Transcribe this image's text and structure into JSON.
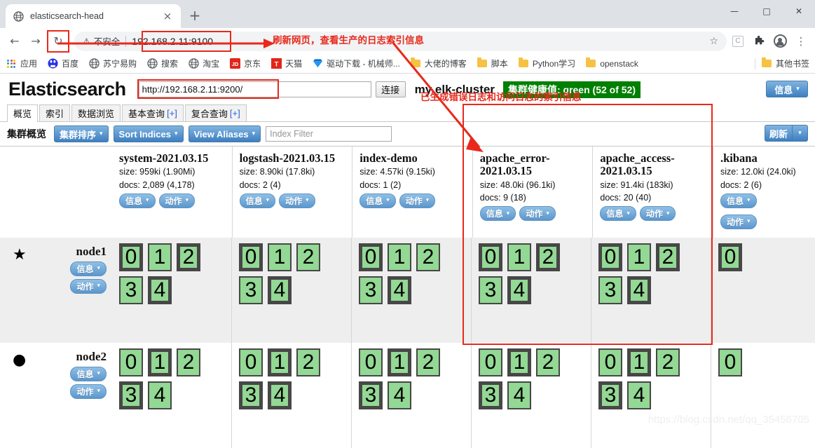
{
  "browser": {
    "tab": {
      "title": "elasticsearch-head",
      "favicon": "globe-icon",
      "close": "×"
    },
    "newtab_label": "+",
    "window_controls": {
      "minimize": "—",
      "maximize": "□",
      "close": "✕"
    },
    "nav": {
      "back": "←",
      "forward": "→",
      "reload": "↻"
    },
    "omnibox": {
      "security_label": "不安全",
      "warning_glyph": "⚠",
      "url": "192.168.2.11:9100",
      "star": "☆",
      "kebab": "⋮"
    },
    "bookmarks": [
      {
        "label": "应用",
        "icon": "apps-grid-icon"
      },
      {
        "label": "百度",
        "icon": "baidu-icon"
      },
      {
        "label": "苏宁易购",
        "icon": "globe-icon"
      },
      {
        "label": "搜索",
        "icon": "globe-icon"
      },
      {
        "label": "淘宝",
        "icon": "globe-icon"
      },
      {
        "label": "京东",
        "icon": "jd-icon"
      },
      {
        "label": "天猫",
        "icon": "tmall-icon"
      },
      {
        "label": "驱动下载 - 机械师...",
        "icon": "diamond-icon"
      },
      {
        "label": "大佬的博客",
        "icon": "folder-icon"
      },
      {
        "label": "脚本",
        "icon": "folder-icon"
      },
      {
        "label": "Python学习",
        "icon": "folder-icon"
      },
      {
        "label": "openstack",
        "icon": "folder-icon"
      }
    ],
    "other_bookmarks": {
      "label": "其他书签",
      "icon": "folder-icon"
    }
  },
  "app": {
    "logo": "Elasticsearch",
    "connect_url_value": "http://192.168.2.11:9200/",
    "connect_button": "连接",
    "cluster_name": "my elk-cluster",
    "health_badge": "集群健康值: green (52 of 52)",
    "health_color": "#008000",
    "info_button": "信息",
    "caret": "▾",
    "tabs": [
      {
        "label": "概览",
        "plus": "",
        "active": true
      },
      {
        "label": "索引",
        "plus": "",
        "active": false
      },
      {
        "label": "数据浏览",
        "plus": "",
        "active": false
      },
      {
        "label": "基本查询",
        "plus": "[+]",
        "active": false
      },
      {
        "label": "复合查询",
        "plus": "[+]",
        "active": false
      }
    ],
    "subbar": {
      "title": "集群概览",
      "sort_cluster": "集群排序",
      "sort_indices": "Sort Indices",
      "view_aliases": "View Aliases",
      "index_filter_placeholder": "Index Filter",
      "refresh": "刷新"
    },
    "buttons": {
      "info": "信息",
      "action": "动作"
    }
  },
  "cluster": {
    "indices": [
      {
        "name": "system-2021.03.15",
        "size": "size: 959ki (1.90Mi)",
        "docs": "docs: 2,089 (4,178)",
        "highlighted": false
      },
      {
        "name": "logstash-2021.03.15",
        "size": "size: 8.90ki (17.8ki)",
        "docs": "docs: 2 (4)",
        "highlighted": false
      },
      {
        "name": "index-demo",
        "size": "size: 4.57ki (9.15ki)",
        "docs": "docs: 1 (2)",
        "highlighted": false
      },
      {
        "name": "apache_error-2021.03.15",
        "size": "size: 48.0ki (96.1ki)",
        "docs": "docs: 9 (18)",
        "highlighted": true
      },
      {
        "name": "apache_access-2021.03.15",
        "size": "size: 91.4ki (183ki)",
        "docs": "docs: 20 (40)",
        "highlighted": true
      },
      {
        "name": ".kibana",
        "size": "size: 12.0ki (24.0ki)",
        "docs": "docs: 2 (6)",
        "highlighted": false
      }
    ],
    "nodes": [
      {
        "name": "node1",
        "marker": "★",
        "marker_title": "master-node-star-icon",
        "shards": [
          [
            {
              "n": "0",
              "p": true
            },
            {
              "n": "1",
              "p": false
            },
            {
              "n": "2",
              "p": true
            },
            {
              "n": "3",
              "p": false
            },
            {
              "n": "4",
              "p": true
            }
          ],
          [
            {
              "n": "0",
              "p": true
            },
            {
              "n": "1",
              "p": false
            },
            {
              "n": "2",
              "p": false
            },
            {
              "n": "3",
              "p": false
            },
            {
              "n": "4",
              "p": true
            }
          ],
          [
            {
              "n": "0",
              "p": true
            },
            {
              "n": "1",
              "p": false
            },
            {
              "n": "2",
              "p": false
            },
            {
              "n": "3",
              "p": false
            },
            {
              "n": "4",
              "p": true
            }
          ],
          [
            {
              "n": "0",
              "p": true
            },
            {
              "n": "1",
              "p": false
            },
            {
              "n": "2",
              "p": true
            },
            {
              "n": "3",
              "p": false
            },
            {
              "n": "4",
              "p": true
            }
          ],
          [
            {
              "n": "0",
              "p": true
            },
            {
              "n": "1",
              "p": false
            },
            {
              "n": "2",
              "p": true
            },
            {
              "n": "3",
              "p": false
            },
            {
              "n": "4",
              "p": true
            }
          ],
          [
            {
              "n": "0",
              "p": true
            }
          ]
        ]
      },
      {
        "name": "node2",
        "marker": "●",
        "marker_title": "data-node-dot-icon",
        "shards": [
          [
            {
              "n": "0",
              "p": false
            },
            {
              "n": "1",
              "p": true
            },
            {
              "n": "2",
              "p": false
            },
            {
              "n": "3",
              "p": true
            },
            {
              "n": "4",
              "p": false
            }
          ],
          [
            {
              "n": "0",
              "p": false
            },
            {
              "n": "1",
              "p": true
            },
            {
              "n": "2",
              "p": false
            },
            {
              "n": "3",
              "p": true
            },
            {
              "n": "4",
              "p": true
            }
          ],
          [
            {
              "n": "0",
              "p": false
            },
            {
              "n": "1",
              "p": true
            },
            {
              "n": "2",
              "p": false
            },
            {
              "n": "3",
              "p": true
            },
            {
              "n": "4",
              "p": false
            }
          ],
          [
            {
              "n": "0",
              "p": false
            },
            {
              "n": "1",
              "p": true
            },
            {
              "n": "2",
              "p": false
            },
            {
              "n": "3",
              "p": true
            },
            {
              "n": "4",
              "p": false
            }
          ],
          [
            {
              "n": "0",
              "p": false
            },
            {
              "n": "1",
              "p": true
            },
            {
              "n": "2",
              "p": false
            },
            {
              "n": "3",
              "p": true
            },
            {
              "n": "4",
              "p": false
            }
          ],
          [
            {
              "n": "0",
              "p": false
            }
          ]
        ]
      }
    ]
  },
  "annotations": {
    "refresh_note": "刷新网页，查看生产的日志索引信息",
    "indices_note": "已生成错误日志和访问日志的索引信息",
    "color": "#e8291c"
  },
  "watermark": "https://blog.csdn.net/qq_35456705"
}
